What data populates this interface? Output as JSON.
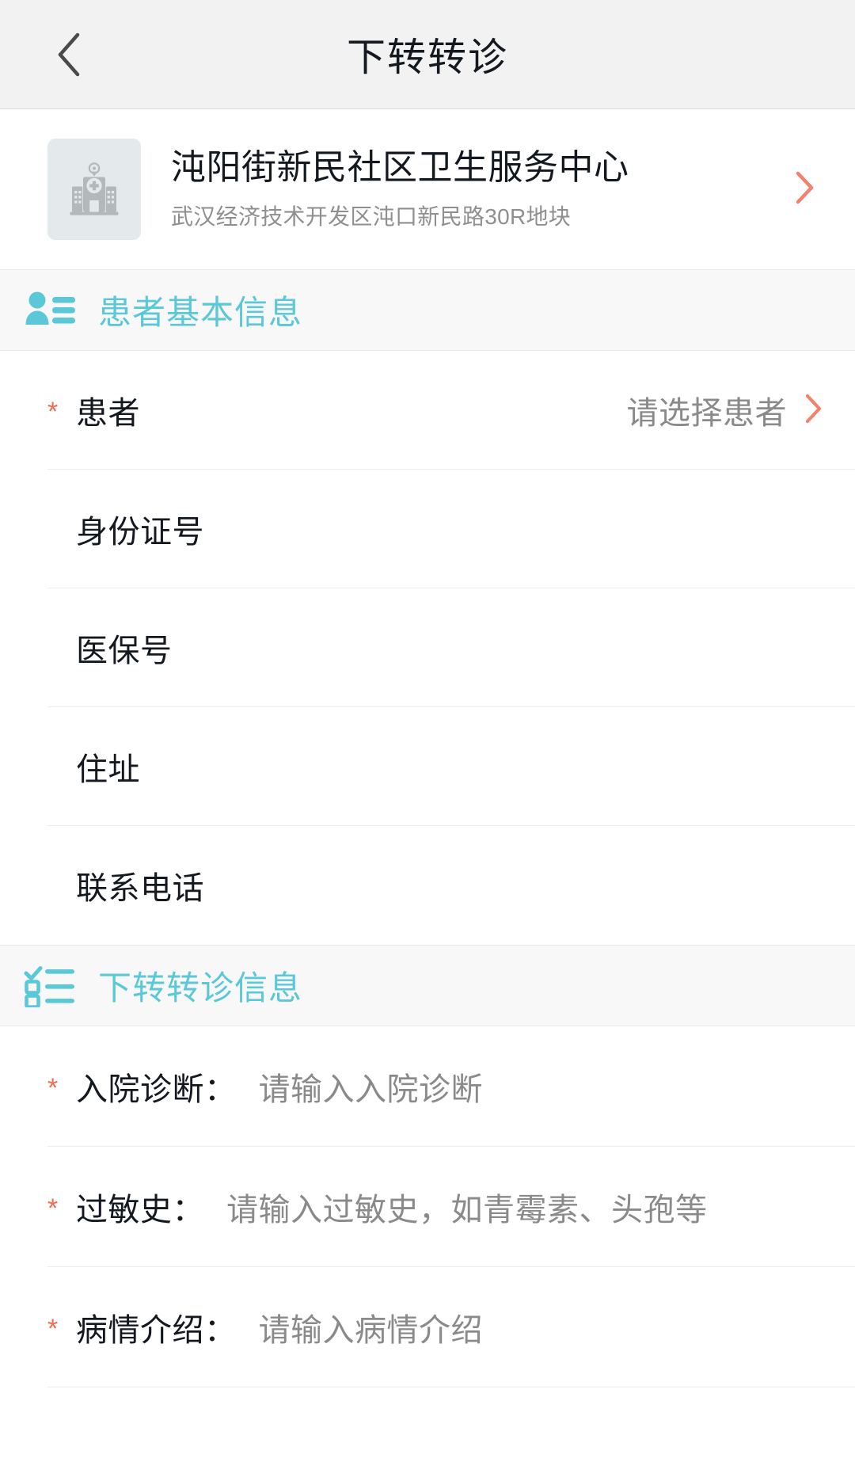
{
  "navbar": {
    "title": "下转转诊",
    "back_icon": "chevron-left-icon"
  },
  "hospital": {
    "icon": "hospital-building-icon",
    "name": "沌阳街新民社区卫生服务中心",
    "address": "武汉经济技术开发区沌口新民路30R地块",
    "chevron_icon": "chevron-right-icon"
  },
  "colors": {
    "accent_cyan": "#5bc8d8",
    "accent_coral": "#f4816e",
    "required_star": "#f4694f",
    "text_primary": "#14181f",
    "text_secondary": "#8a8a8a",
    "navbar_bg": "#f2f2f2",
    "section_bg": "#f8f8f8",
    "thumb_bg": "#e4eaec"
  },
  "patient_section": {
    "icon": "user-list-icon",
    "title": "患者基本信息",
    "rows": [
      {
        "required": true,
        "label": "患者",
        "value": "请选择患者",
        "chevron": true,
        "star": "*"
      },
      {
        "required": false,
        "label": "身份证号",
        "value": "",
        "chevron": false,
        "star": "*"
      },
      {
        "required": false,
        "label": "医保号",
        "value": "",
        "chevron": false,
        "star": "*"
      },
      {
        "required": false,
        "label": "住址",
        "value": "",
        "chevron": false,
        "star": "*"
      },
      {
        "required": false,
        "label": "联系电话",
        "value": "",
        "chevron": false,
        "star": "*"
      }
    ]
  },
  "referral_section": {
    "icon": "checklist-icon",
    "title": "下转转诊信息",
    "rows": [
      {
        "star": "*",
        "label": "入院诊断：",
        "placeholder": "请输入入院诊断"
      },
      {
        "star": "*",
        "label": "过敏史：",
        "placeholder": "请输入过敏史，如青霉素、头孢等"
      },
      {
        "star": "*",
        "label": "病情介绍：",
        "placeholder": "请输入病情介绍"
      }
    ]
  }
}
